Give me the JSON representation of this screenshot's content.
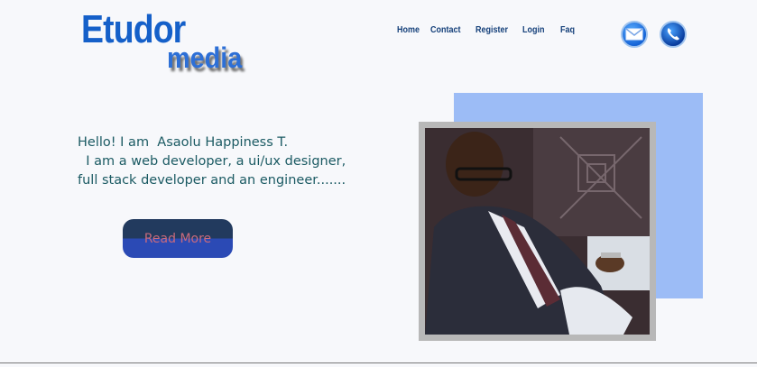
{
  "logo": {
    "main": "Etudor",
    "sub": "media"
  },
  "nav": {
    "items": [
      {
        "label": "Home"
      },
      {
        "label": "Contact"
      },
      {
        "label": "Register"
      },
      {
        "label": "Login"
      },
      {
        "label": "Faq"
      }
    ]
  },
  "icons": {
    "mail": "envelope-icon",
    "phone": "phone-icon"
  },
  "hero": {
    "line1": "Hello! I am  Asaolu Happiness T.",
    "line2": "  I am a web developer, a ui/ux designer,",
    "line3": "full stack developer and an engineer.......",
    "button_label": "Read More"
  },
  "colors": {
    "brand": "#1560c9",
    "nav_text": "#15407a",
    "intro_text": "#1b5a63",
    "button_top": "#223a5e",
    "button_bottom": "#2b4ab5",
    "button_text": "#c86a7c",
    "accent_box": "#9cbcf6"
  }
}
